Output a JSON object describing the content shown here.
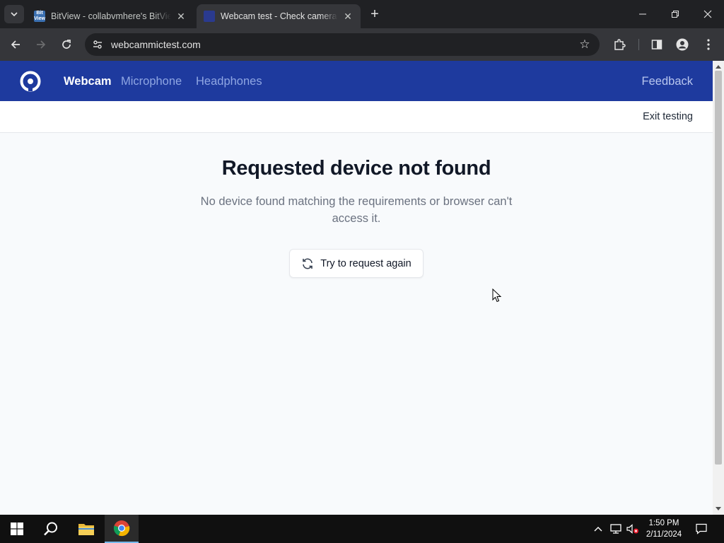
{
  "browser": {
    "tabs": [
      {
        "title": "BitView - collabvmhere's BitView",
        "favicon_text": "Bit View",
        "active": false
      },
      {
        "title": "Webcam test - Check camera online",
        "active": true
      }
    ],
    "url": "webcammictest.com"
  },
  "site": {
    "nav": {
      "items": [
        "Webcam",
        "Microphone",
        "Headphones"
      ],
      "active": "Webcam",
      "feedback": "Feedback"
    },
    "subbar": {
      "exit": "Exit testing"
    },
    "main": {
      "heading": "Requested device not found",
      "description": "No device found matching the requirements or browser can't access it.",
      "retry_button": "Try to request again"
    }
  },
  "taskbar": {
    "time": "1:50 PM",
    "date": "2/11/2024"
  },
  "colors": {
    "brand_nav": "#1e3a9e",
    "page_bg": "#f8fafc",
    "heading": "#111827",
    "muted_text": "#6b7280"
  }
}
